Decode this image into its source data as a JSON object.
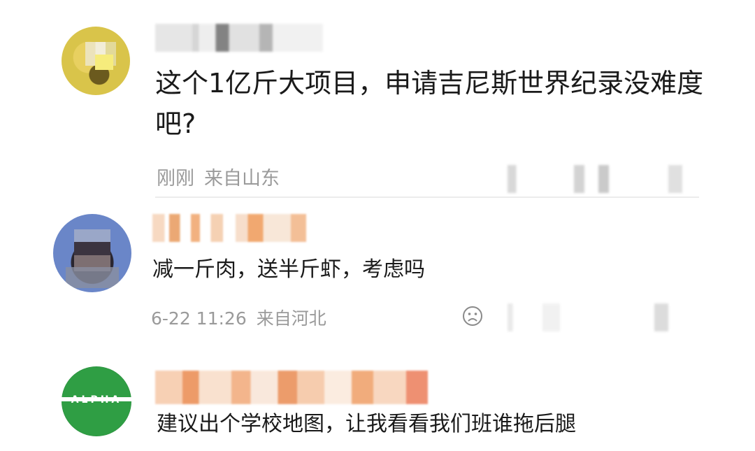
{
  "comments": [
    {
      "id": 1,
      "avatar": "blurred-avatar-yellow",
      "username_obscured": true,
      "text": "这个1亿斤大项目，申请吉尼斯世界纪录没难度吧?",
      "time": "刚刚",
      "location": "来自山东"
    },
    {
      "id": 2,
      "avatar": "blurred-avatar-blue",
      "username_obscured": true,
      "text": "减一斤肉，送半斤虾，考虑吗",
      "time": "6-22 11:26",
      "location": "来自河北",
      "reaction_icon": "sad-face-icon"
    },
    {
      "id": 3,
      "avatar": "blurred-avatar-green",
      "avatar_label": "ALPHA",
      "username_obscured": true,
      "text": "建议出个学校地图，让我看看我们班谁拖后腿"
    }
  ],
  "colors": {
    "text": "#1a1a1a",
    "meta": "#9a9a9a",
    "divider": "#ececec"
  }
}
